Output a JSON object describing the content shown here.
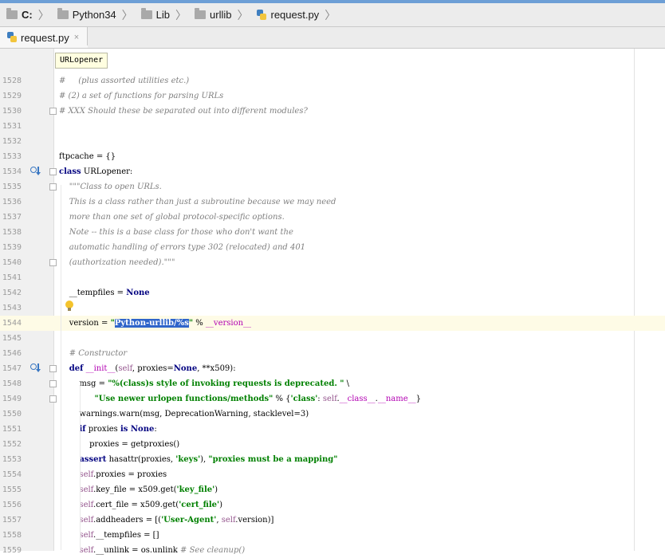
{
  "breadcrumb": {
    "items": [
      "C:",
      "Python34",
      "Lib",
      "urllib",
      "request.py"
    ]
  },
  "tab": {
    "label": "request.py",
    "close": "×"
  },
  "hint": {
    "text": "URLopener"
  },
  "lines": [
    {
      "num": "1528",
      "html": "<span class=\"cm\">#     (plus assorted utilities etc.)</span>"
    },
    {
      "num": "1529",
      "html": "<span class=\"cm\"># (2) a set of functions for parsing URLs</span>"
    },
    {
      "num": "1530",
      "html": "<span class=\"cm\"># XXX Should these be separated out into different modules?</span>"
    },
    {
      "num": "1531",
      "html": ""
    },
    {
      "num": "1532",
      "html": ""
    },
    {
      "num": "1533",
      "html": "ftpcache = {}"
    },
    {
      "num": "1534",
      "html": "<span class=\"kw\">class</span> URLopener:"
    },
    {
      "num": "1535",
      "html": "    <span class=\"ds\">\"\"\"Class to open URLs.</span>"
    },
    {
      "num": "1536",
      "html": "<span class=\"ds\">    This is a class rather than just a subroutine because we may need</span>"
    },
    {
      "num": "1537",
      "html": "<span class=\"ds\">    more than one set of global protocol-specific options.</span>"
    },
    {
      "num": "1538",
      "html": "<span class=\"ds\">    Note -- this is a base class for those who don't want the</span>"
    },
    {
      "num": "1539",
      "html": "<span class=\"ds\">    automatic handling of errors type 302 (relocated) and 401</span>"
    },
    {
      "num": "1540",
      "html": "<span class=\"ds\">    (authorization needed).\"\"\"</span>"
    },
    {
      "num": "1541",
      "html": ""
    },
    {
      "num": "1542",
      "html": "    __tempfiles = <span class=\"kw\">None</span>"
    },
    {
      "num": "1543",
      "html": ""
    },
    {
      "num": "1544",
      "html": "    version = <span class=\"st\">\"</span><span class=\"st sel\">Python-urllib/%s</span><span class=\"st\">\"</span> % <span class=\"mg\">__version__</span>"
    },
    {
      "num": "1545",
      "html": ""
    },
    {
      "num": "1546",
      "html": "    <span class=\"cm\"># Constructor</span>"
    },
    {
      "num": "1547",
      "html": "    <span class=\"kw\">def</span> <span class=\"mg\">__init__</span>(<span class=\"sf\">self</span>, proxies=<span class=\"kw\">None</span>, **x509):"
    },
    {
      "num": "1548",
      "html": "        msg = <span class=\"st\">\"%(class)s style of invoking requests is deprecated. \"</span> \\"
    },
    {
      "num": "1549",
      "html": "              <span class=\"st\">\"Use newer urlopen functions/methods\"</span> % {<span class=\"st\">'class'</span>: <span class=\"sf\">self</span>.<span class=\"mg\">__class__</span>.<span class=\"mg\">__name__</span>}"
    },
    {
      "num": "1550",
      "html": "        warnings.warn(msg, DeprecationWarning, stacklevel=3)"
    },
    {
      "num": "1551",
      "html": "        <span class=\"kw\">if</span> proxies <span class=\"kw\">is None</span>:"
    },
    {
      "num": "1552",
      "html": "            proxies = getproxies()"
    },
    {
      "num": "1553",
      "html": "        <span class=\"kw\">assert</span> hasattr(proxies, <span class=\"st\">'keys'</span>), <span class=\"st\">\"proxies must be a mapping\"</span>"
    },
    {
      "num": "1554",
      "html": "        <span class=\"sf\">self</span>.proxies = proxies"
    },
    {
      "num": "1555",
      "html": "        <span class=\"sf\">self</span>.key_file = x509.get(<span class=\"st\">'key_file'</span>)"
    },
    {
      "num": "1556",
      "html": "        <span class=\"sf\">self</span>.cert_file = x509.get(<span class=\"st\">'cert_file'</span>)"
    },
    {
      "num": "1557",
      "html": "        <span class=\"sf\">self</span>.addheaders = [(<span class=\"st\">'User-Agent'</span>, <span class=\"sf\">self</span>.version)]"
    },
    {
      "num": "1558",
      "html": "        <span class=\"sf\">self</span>.__tempfiles = []"
    },
    {
      "num": "1559",
      "html": "        <span class=\"sf\">self</span>.__unlink = os.unlink <span class=\"cm\"># See cleanup()</span>"
    }
  ],
  "colors": {
    "keyword": "#000080",
    "string": "#008000",
    "comment": "#808080",
    "selection": "#2f65ca",
    "current_line": "#fefbe6"
  }
}
